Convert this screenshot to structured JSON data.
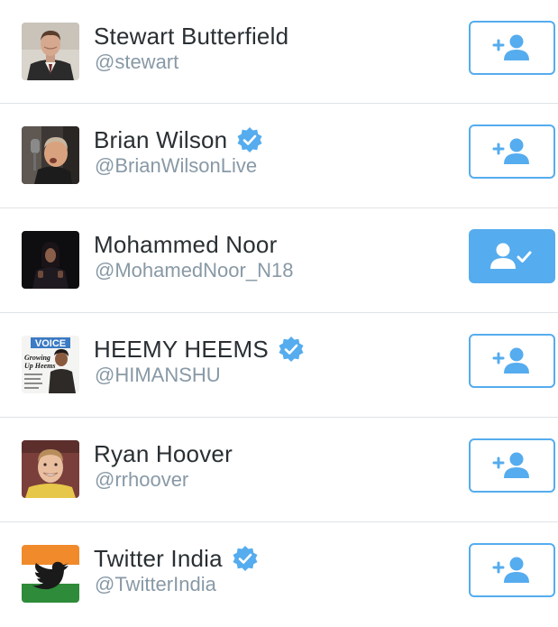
{
  "accent_color": "#55acee",
  "users": [
    {
      "name": "Stewart Butterfield",
      "handle": "@stewart",
      "verified": false,
      "following": false,
      "avatar_icon": "man-in-suit-avatar",
      "button_icon": "add-user-icon"
    },
    {
      "name": "Brian Wilson",
      "handle": "@BrianWilsonLive",
      "verified": true,
      "following": false,
      "avatar_icon": "singer-at-microphone-avatar",
      "button_icon": "add-user-icon"
    },
    {
      "name": "Mohammed Noor",
      "handle": "@MohamedNoor_N18",
      "verified": false,
      "following": true,
      "avatar_icon": "person-in-dark-avatar",
      "button_icon": "user-following-check-icon"
    },
    {
      "name": "HEEMY HEEMS",
      "handle": "@HIMANSHU",
      "verified": true,
      "following": false,
      "avatar_icon": "magazine-cover-avatar",
      "avatar_text": {
        "masthead": "VOICE",
        "headline_1": "Growing",
        "headline_2": "Up Heems"
      },
      "button_icon": "add-user-icon"
    },
    {
      "name": "Ryan Hoover",
      "handle": "@rrhoover",
      "verified": false,
      "following": false,
      "avatar_icon": "smiling-man-avatar",
      "button_icon": "add-user-icon"
    },
    {
      "name": "Twitter India",
      "handle": "@TwitterIndia",
      "verified": true,
      "following": false,
      "avatar_icon": "twitter-bird-india-flag-avatar",
      "button_icon": "add-user-icon"
    }
  ]
}
